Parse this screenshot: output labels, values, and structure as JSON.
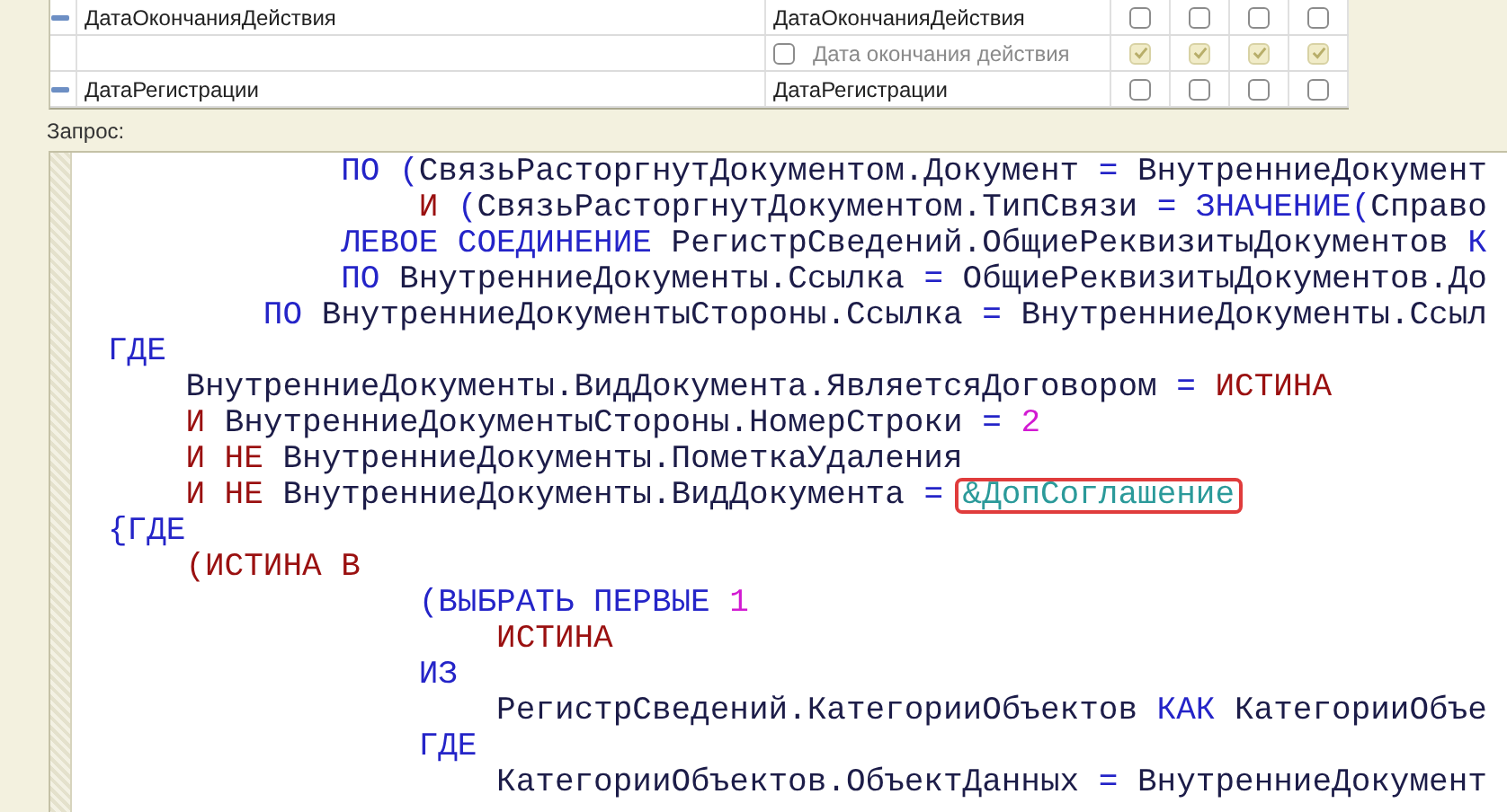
{
  "fields_table": {
    "rows": [
      {
        "name": "ДатаОкончанияДействия",
        "path": "ДатаОкончанияДействия",
        "flags": [
          {
            "checked": false
          },
          {
            "checked": false
          },
          {
            "checked": false
          },
          {
            "checked": false
          }
        ],
        "title_used": false,
        "title": "Дата окончания действия",
        "title_flags": [
          {
            "checked": true
          },
          {
            "checked": true
          },
          {
            "checked": true
          },
          {
            "checked": true
          }
        ]
      },
      {
        "name": "ДатаРегистрации",
        "path": "ДатаРегистрации",
        "flags": [
          {
            "checked": false
          },
          {
            "checked": false
          },
          {
            "checked": false
          },
          {
            "checked": false
          }
        ]
      }
    ]
  },
  "query_label": "Запрос:",
  "query_lines": [
    {
      "tokens": [
        {
          "kind": "keyword",
          "text": "            ПО ("
        },
        {
          "kind": "identifier",
          "text": "СвязьРасторгнутДокументом.Документ "
        },
        {
          "kind": "keyword",
          "text": "="
        },
        {
          "kind": "identifier",
          "text": " ВнутренниеДокумент"
        }
      ]
    },
    {
      "tokens": [
        {
          "kind": "operator",
          "text": "                И "
        },
        {
          "kind": "keyword",
          "text": "("
        },
        {
          "kind": "identifier",
          "text": "СвязьРасторгнутДокументом.ТипСвязи "
        },
        {
          "kind": "keyword",
          "text": "= ЗНАЧЕНИЕ("
        },
        {
          "kind": "identifier",
          "text": "Справо"
        }
      ]
    },
    {
      "tokens": [
        {
          "kind": "keyword",
          "text": "            ЛЕВОЕ СОЕДИНЕНИЕ "
        },
        {
          "kind": "identifier",
          "text": "РегистрСведений.ОбщиеРеквизитыДокументов "
        },
        {
          "kind": "keyword",
          "text": "К"
        }
      ]
    },
    {
      "tokens": [
        {
          "kind": "keyword",
          "text": "            ПО "
        },
        {
          "kind": "identifier",
          "text": "ВнутренниеДокументы.Ссылка "
        },
        {
          "kind": "keyword",
          "text": "="
        },
        {
          "kind": "identifier",
          "text": " ОбщиеРеквизитыДокументов.До"
        }
      ]
    },
    {
      "tokens": [
        {
          "kind": "keyword",
          "text": "        ПО "
        },
        {
          "kind": "identifier",
          "text": "ВнутренниеДокументыСтороны.Ссылка "
        },
        {
          "kind": "keyword",
          "text": "="
        },
        {
          "kind": "identifier",
          "text": " ВнутренниеДокументы.Ссыл"
        }
      ]
    },
    {
      "tokens": [
        {
          "kind": "keyword",
          "text": "ГДЕ"
        }
      ]
    },
    {
      "tokens": [
        {
          "kind": "identifier",
          "text": "    ВнутренниеДокументы.ВидДокумента.ЯвляетсяДоговором "
        },
        {
          "kind": "keyword",
          "text": "= "
        },
        {
          "kind": "operator",
          "text": "ИСТИНА"
        }
      ]
    },
    {
      "tokens": [
        {
          "kind": "operator",
          "text": "    И "
        },
        {
          "kind": "identifier",
          "text": "ВнутренниеДокументыСтороны.НомерСтроки "
        },
        {
          "kind": "keyword",
          "text": "= "
        },
        {
          "kind": "number",
          "text": "2"
        }
      ]
    },
    {
      "tokens": [
        {
          "kind": "operator",
          "text": "    И НЕ "
        },
        {
          "kind": "identifier",
          "text": "ВнутренниеДокументы.ПометкаУдаления"
        }
      ]
    },
    {
      "tokens": [
        {
          "kind": "operator",
          "text": "    И НЕ "
        },
        {
          "kind": "identifier",
          "text": "ВнутренниеДокументы.ВидДокумента "
        },
        {
          "kind": "keyword",
          "text": "= "
        },
        {
          "kind": "parameter",
          "text": "&ДопСоглашение",
          "highlighted": true
        }
      ]
    },
    {
      "tokens": [
        {
          "kind": "keyword",
          "text": "{ГДЕ"
        }
      ]
    },
    {
      "tokens": [
        {
          "kind": "operator",
          "text": "    (ИСТИНА В"
        }
      ]
    },
    {
      "tokens": [
        {
          "kind": "keyword",
          "text": "                (ВЫБРАТЬ ПЕРВЫЕ "
        },
        {
          "kind": "number",
          "text": "1"
        }
      ]
    },
    {
      "tokens": [
        {
          "kind": "operator",
          "text": "                    ИСТИНА"
        }
      ]
    },
    {
      "tokens": [
        {
          "kind": "keyword",
          "text": "                ИЗ"
        }
      ]
    },
    {
      "tokens": [
        {
          "kind": "identifier",
          "text": "                    РегистрСведений.КатегорииОбъектов "
        },
        {
          "kind": "keyword",
          "text": "КАК"
        },
        {
          "kind": "identifier",
          "text": " КатегорииОбъе"
        }
      ]
    },
    {
      "tokens": [
        {
          "kind": "keyword",
          "text": "                ГДЕ"
        }
      ]
    },
    {
      "tokens": [
        {
          "kind": "identifier",
          "text": "                    КатегорииОбъектов.ОбъектДанных "
        },
        {
          "kind": "keyword",
          "text": "="
        },
        {
          "kind": "identifier",
          "text": " ВнутренниеДокумент"
        }
      ]
    }
  ]
}
